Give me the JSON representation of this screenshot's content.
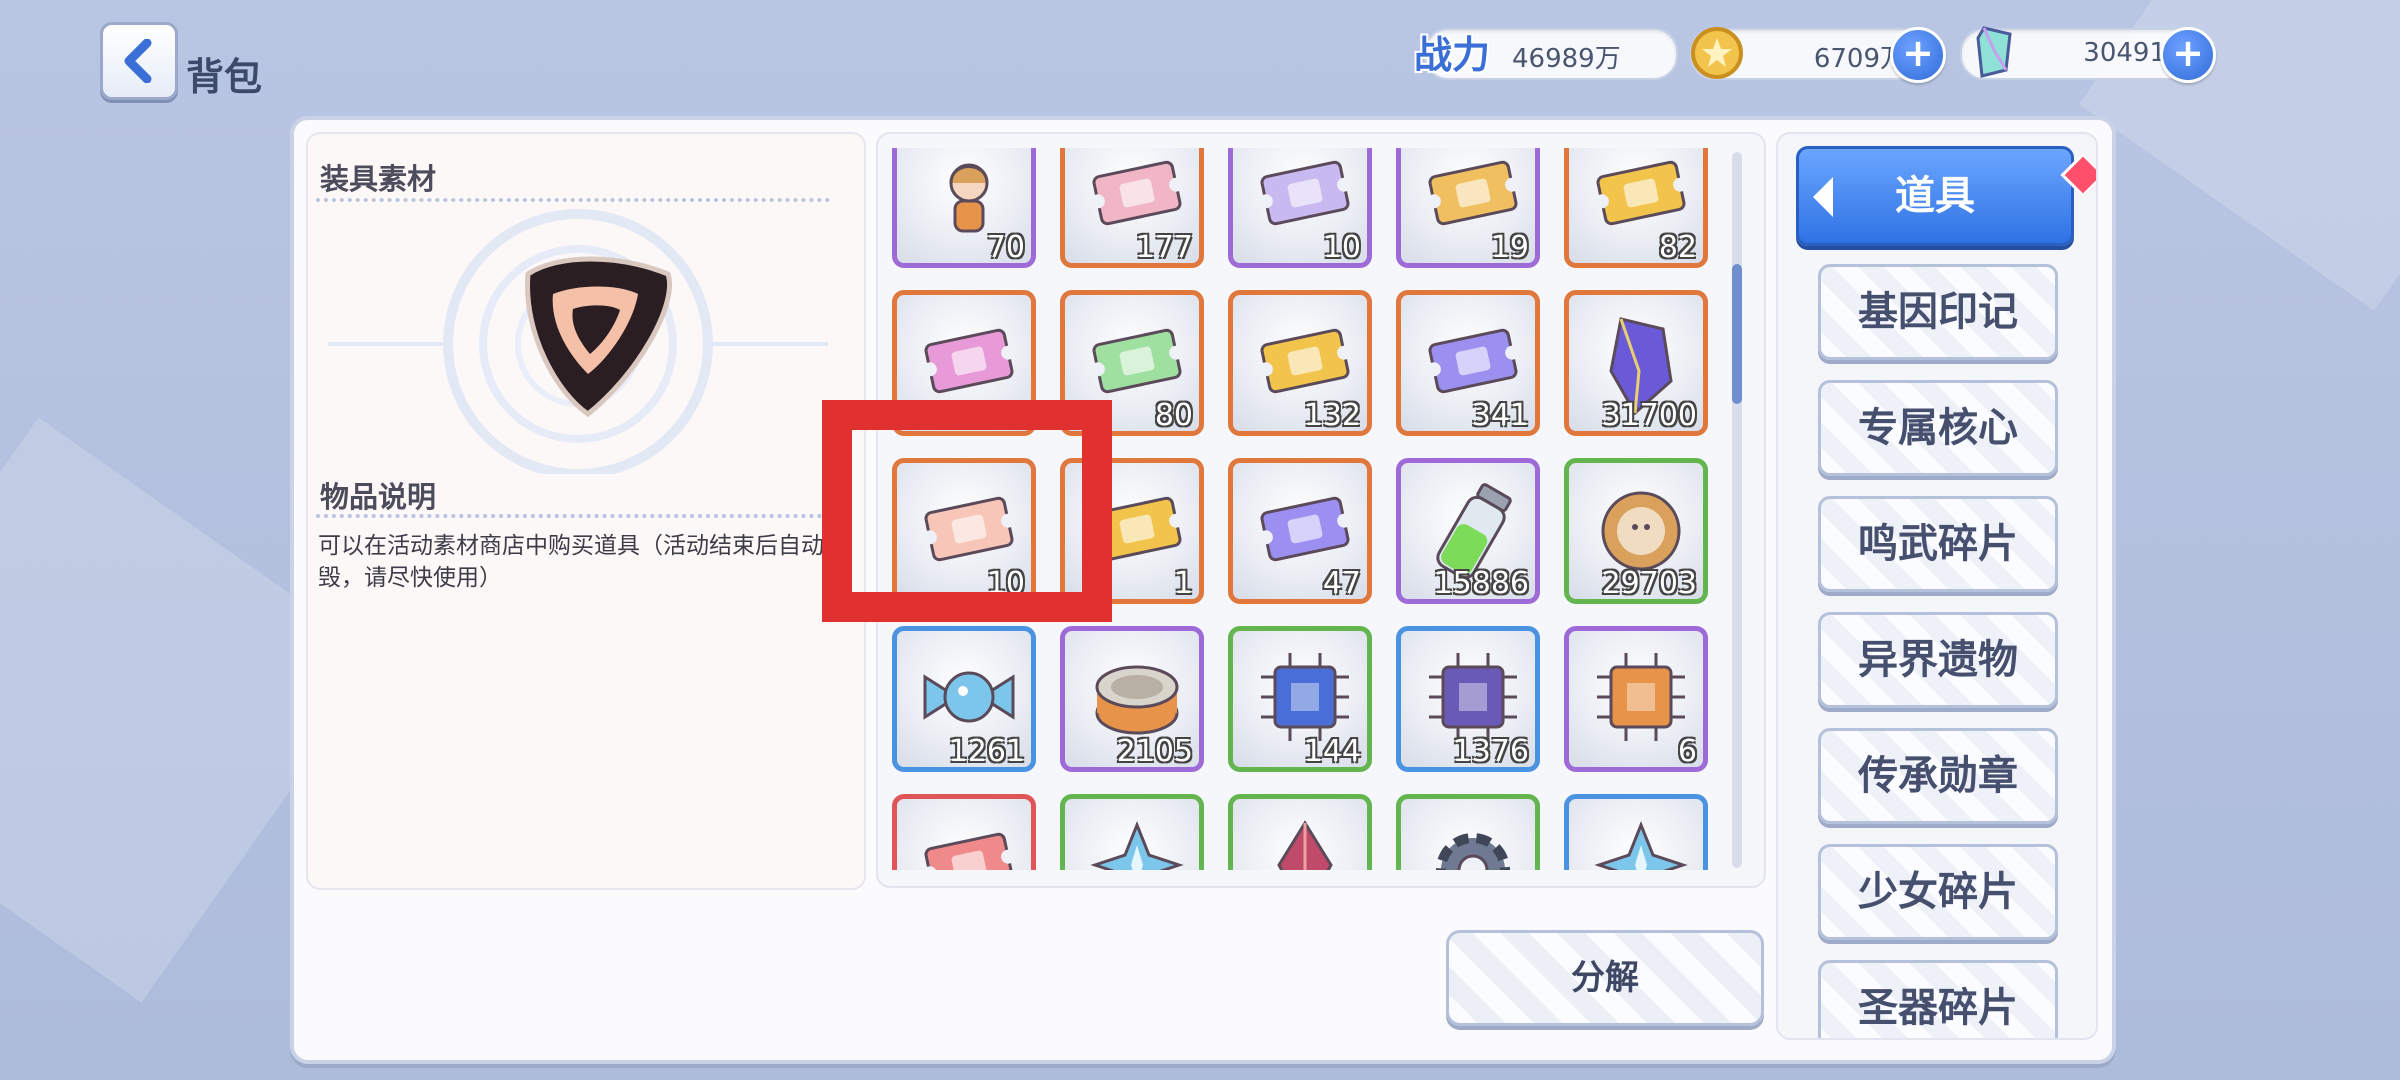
{
  "header": {
    "title": "背包"
  },
  "stats": {
    "power_label": "战力",
    "power": "46989万",
    "gold": "6709万",
    "crystal": "30491"
  },
  "info": {
    "category_title": "装具素材",
    "desc_title": "物品说明",
    "description": "可以在活动素材商店中购买道具（活动结束后自动销毁，请尽快使用）"
  },
  "items": [
    {
      "count": "70",
      "rarity": "purple",
      "icon": "character-icon",
      "color": "#d9a15b"
    },
    {
      "count": "177",
      "rarity": "orange",
      "icon": "ticket-shirt-icon",
      "color": "#f1b6c6"
    },
    {
      "count": "10",
      "rarity": "purple",
      "icon": "ticket-smile-icon",
      "color": "#c8b9f0"
    },
    {
      "count": "19",
      "rarity": "purple",
      "icon": "ticket-dna-icon",
      "color": "#f0c060"
    },
    {
      "count": "82",
      "rarity": "orange",
      "icon": "ticket-gold-icon",
      "color": "#f2c44c"
    },
    {
      "count": "310",
      "rarity": "orange",
      "icon": "ticket-dna-rainbow-icon",
      "color": "#e89ad8"
    },
    {
      "count": "80",
      "rarity": "orange",
      "icon": "ticket-rainbow-icon",
      "color": "#9fe0a0"
    },
    {
      "count": "132",
      "rarity": "orange",
      "icon": "ticket-sword-gold-icon",
      "color": "#f2c44c"
    },
    {
      "count": "341",
      "rarity": "orange",
      "icon": "ticket-sword-purple-icon",
      "color": "#9b8ff0"
    },
    {
      "count": "31700",
      "rarity": "orange",
      "icon": "crystal-icon",
      "color": "#6a5ad8"
    },
    {
      "count": "10",
      "rarity": "orange",
      "icon": "ticket-pink-icon",
      "color": "#f7c6b8"
    },
    {
      "count": "1",
      "rarity": "orange",
      "icon": "ticket-gold-icon",
      "color": "#f2c44c"
    },
    {
      "count": "47",
      "rarity": "orange",
      "icon": "ticket-star-icon",
      "color": "#9c8ff2"
    },
    {
      "count": "15886",
      "rarity": "purple",
      "icon": "potion-icon",
      "color": "#7cdc5a"
    },
    {
      "count": "29703",
      "rarity": "green",
      "icon": "cookie-icon",
      "color": "#d9a15b"
    },
    {
      "count": "1261",
      "rarity": "blue",
      "icon": "candy-icon",
      "color": "#7cc6ec"
    },
    {
      "count": "2105",
      "rarity": "purple",
      "icon": "can-icon",
      "color": "#e8934a"
    },
    {
      "count": "144",
      "rarity": "green",
      "icon": "chip-blue-icon",
      "color": "#4a6ed8"
    },
    {
      "count": "1376",
      "rarity": "blue",
      "icon": "chip-purple-icon",
      "color": "#6a5ab8"
    },
    {
      "count": "6",
      "rarity": "purple",
      "icon": "chip-orange-icon",
      "color": "#e8934a"
    },
    {
      "count": "",
      "rarity": "red",
      "icon": "ticket-red-icon",
      "color": "#f08a8a"
    },
    {
      "count": "",
      "rarity": "green",
      "icon": "ice-crystal-icon",
      "color": "#7cc6ec"
    },
    {
      "count": "",
      "rarity": "green",
      "icon": "gem-red-icon",
      "color": "#c04a6a"
    },
    {
      "count": "",
      "rarity": "green",
      "icon": "gear-icon",
      "color": "#6f7a92"
    },
    {
      "count": "",
      "rarity": "blue",
      "icon": "ice-star-icon",
      "color": "#7cc6ec"
    }
  ],
  "tabs": [
    {
      "label": "道具",
      "active": true
    },
    {
      "label": "基因印记"
    },
    {
      "label": "专属核心"
    },
    {
      "label": "鸣武碎片"
    },
    {
      "label": "异界遗物"
    },
    {
      "label": "传承勋章"
    },
    {
      "label": "少女碎片"
    },
    {
      "label": "圣器碎片"
    }
  ],
  "actions": {
    "decompose": "分解"
  }
}
